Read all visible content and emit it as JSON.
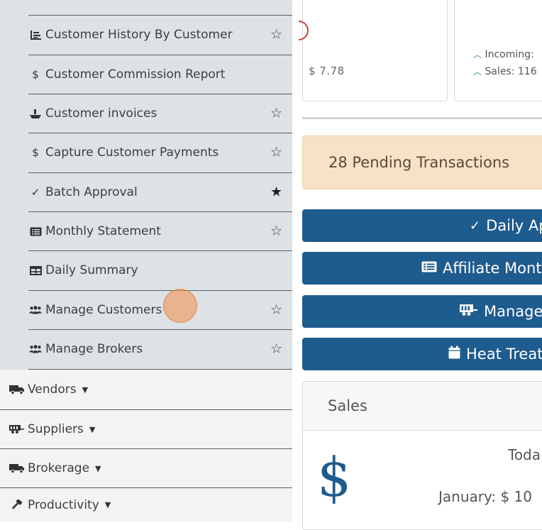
{
  "sidebar": {
    "sub_items": [
      {
        "label": "",
        "icon": "unknown-icon",
        "star": "☆",
        "star_filled": false
      },
      {
        "label": "Customer History By Customer",
        "icon": "chart-icon",
        "star": "☆",
        "star_filled": false
      },
      {
        "label": "Customer Commission Report",
        "icon": "dollar-icon",
        "star": "",
        "star_filled": false
      },
      {
        "label": "Customer invoices",
        "icon": "ship-icon",
        "star": "☆",
        "star_filled": false
      },
      {
        "label": "Capture Customer Payments",
        "icon": "dollar-icon",
        "star": "☆",
        "star_filled": false
      },
      {
        "label": "Batch Approval",
        "icon": "check-icon",
        "star": "★",
        "star_filled": true
      },
      {
        "label": "Monthly Statement",
        "icon": "list-icon",
        "star": "☆",
        "star_filled": false
      },
      {
        "label": "Daily Summary",
        "icon": "table-icon",
        "star": "",
        "star_filled": false
      },
      {
        "label": "Manage Customers",
        "icon": "users-icon",
        "star": "☆",
        "star_filled": false
      },
      {
        "label": "Manage Brokers",
        "icon": "users-icon",
        "star": "☆",
        "star_filled": false
      }
    ],
    "main_items": [
      {
        "label": "Vendors",
        "icon": "truck-icon"
      },
      {
        "label": "Suppliers",
        "icon": "trailer-icon"
      },
      {
        "label": "Brokerage",
        "icon": "truck-icon"
      },
      {
        "label": "Productivity",
        "icon": "hammer-icon"
      }
    ]
  },
  "top_cards": {
    "left_value": "$ 7.78",
    "incoming_label": "Incoming:",
    "sales_label": "Sales: 116"
  },
  "pending": {
    "text": "28 Pending Transactions"
  },
  "buttons": [
    {
      "label": "Daily Ap",
      "icon": "check-icon"
    },
    {
      "label": "Affiliate Month",
      "icon": "list-icon"
    },
    {
      "label": "Manage",
      "icon": "trailer-icon"
    },
    {
      "label": "Heat Treat",
      "icon": "calendar-icon"
    }
  ],
  "sales": {
    "title": "Sales",
    "symbol": "$",
    "today_label": "Toda",
    "january_label": "January: $ 10"
  },
  "colors": {
    "primary": "#1e5b8e",
    "pending_bg": "#f7e2c7",
    "submenu_bg": "#dde2e6",
    "accent_green": "#3a9a46",
    "accent_red": "#c24242"
  }
}
